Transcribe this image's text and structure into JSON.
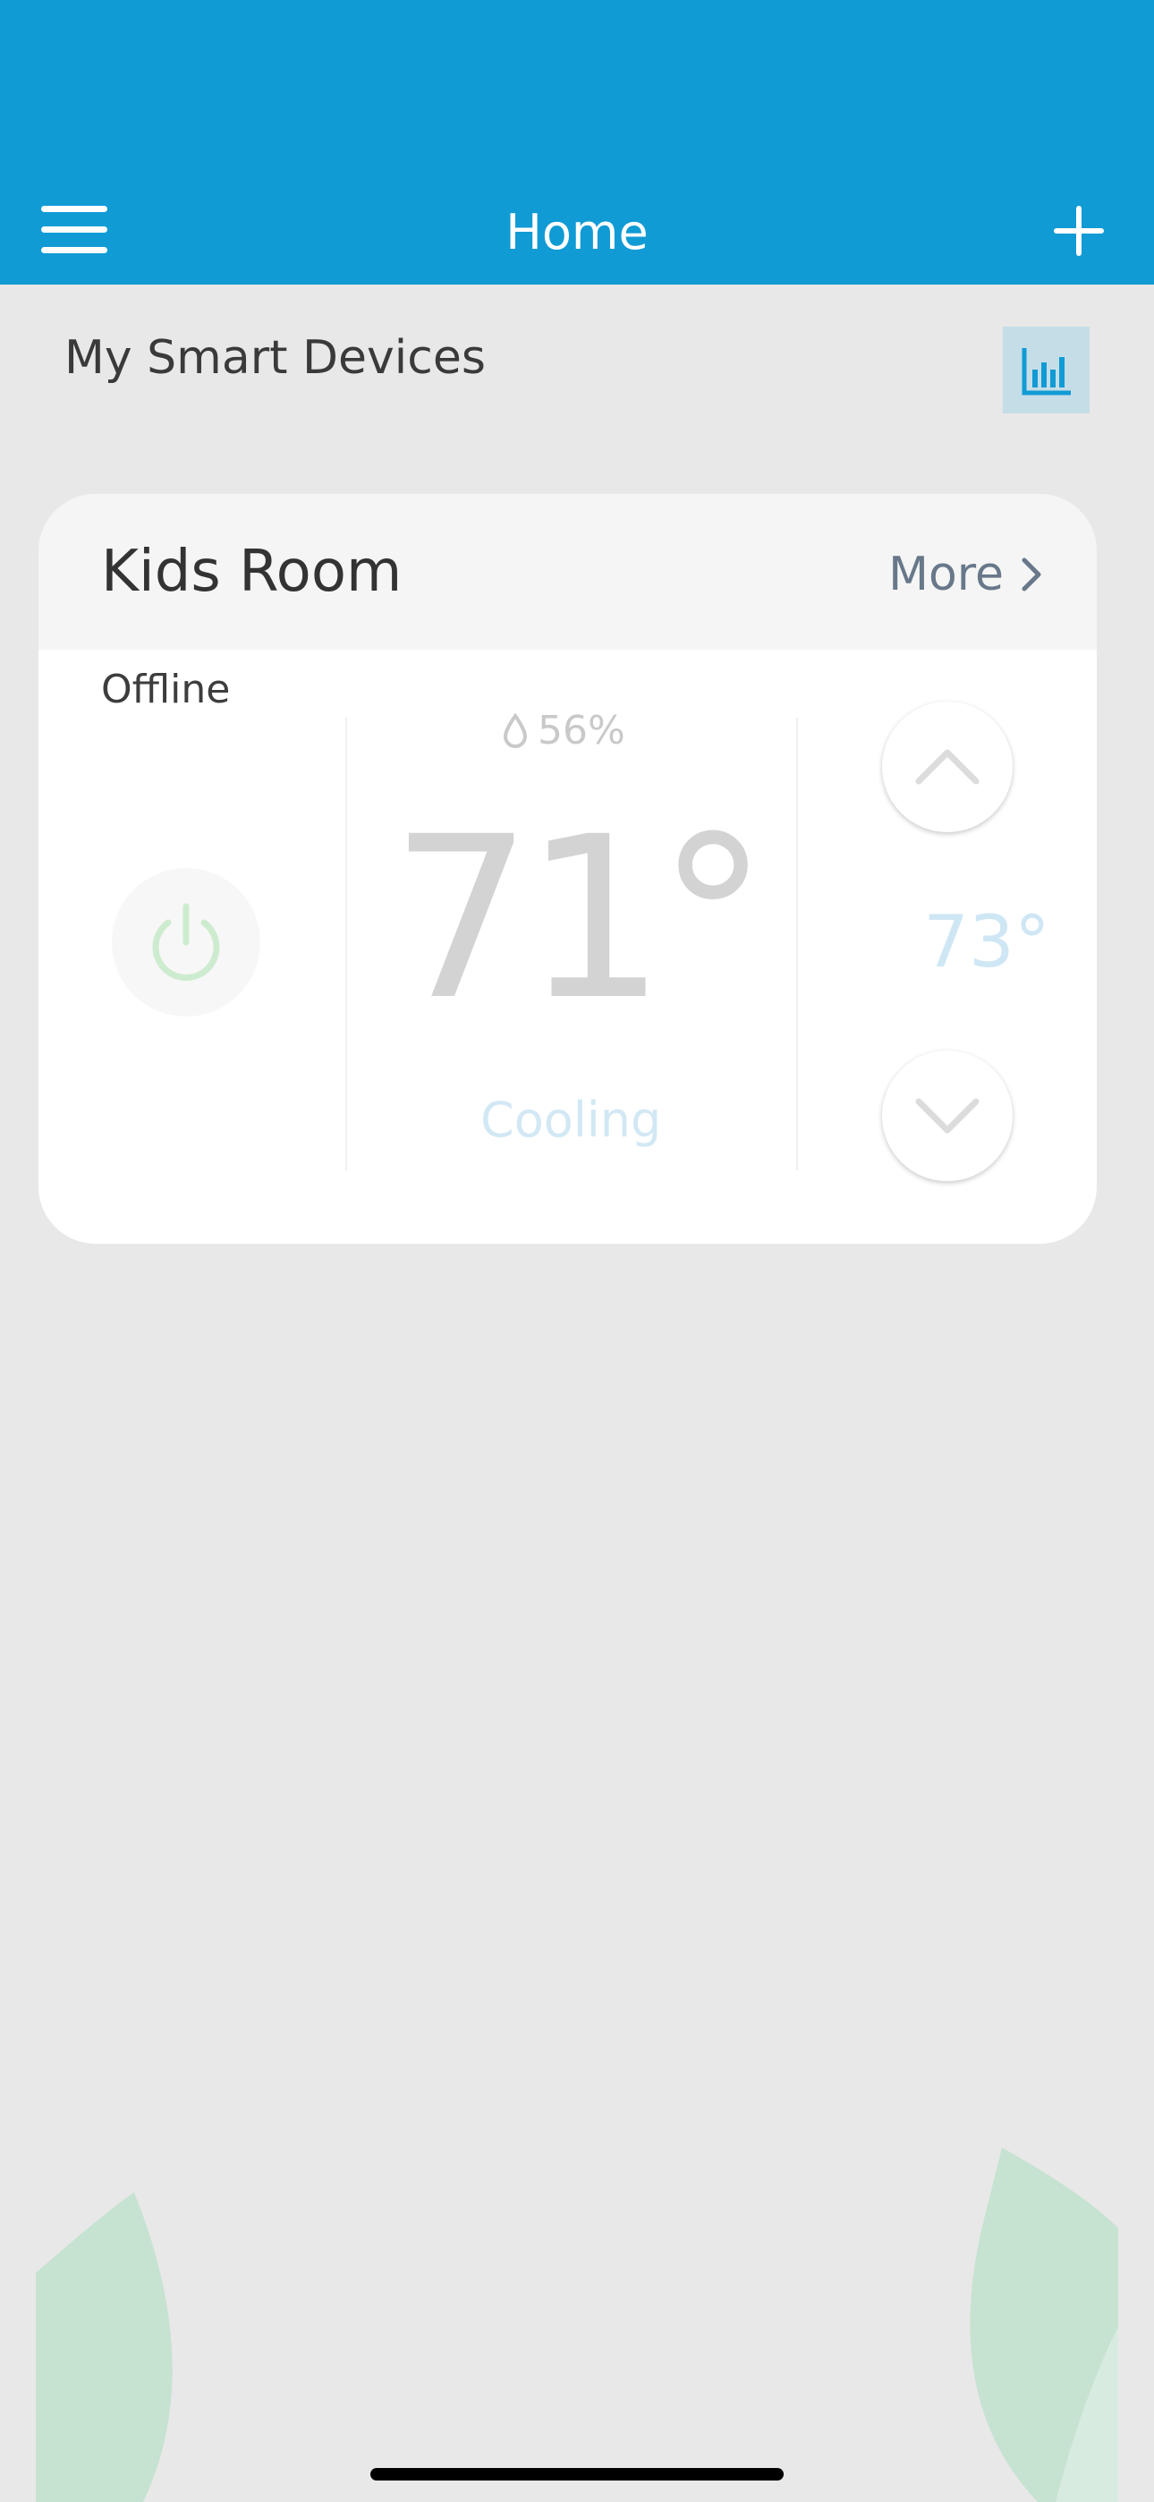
{
  "header": {
    "title": "Home"
  },
  "section": {
    "title": "My Smart Devices"
  },
  "device": {
    "name": "Kids Room",
    "more_label": "More",
    "status": "Offline",
    "humidity": "56%",
    "temperature": "71°",
    "mode": "Cooling",
    "setpoint": "73°"
  },
  "colors": {
    "header_bg": "#119bd5",
    "accent": "#119bd5",
    "page_bg": "#e8e8e8",
    "power_green": "#cdeccf",
    "leaf_green": "#c6e2d1"
  },
  "icons": [
    "menu-icon",
    "plus-icon",
    "bar-chart-icon",
    "chevron-right-icon",
    "power-icon",
    "droplet-icon",
    "chevron-up-icon",
    "chevron-down-icon"
  ]
}
